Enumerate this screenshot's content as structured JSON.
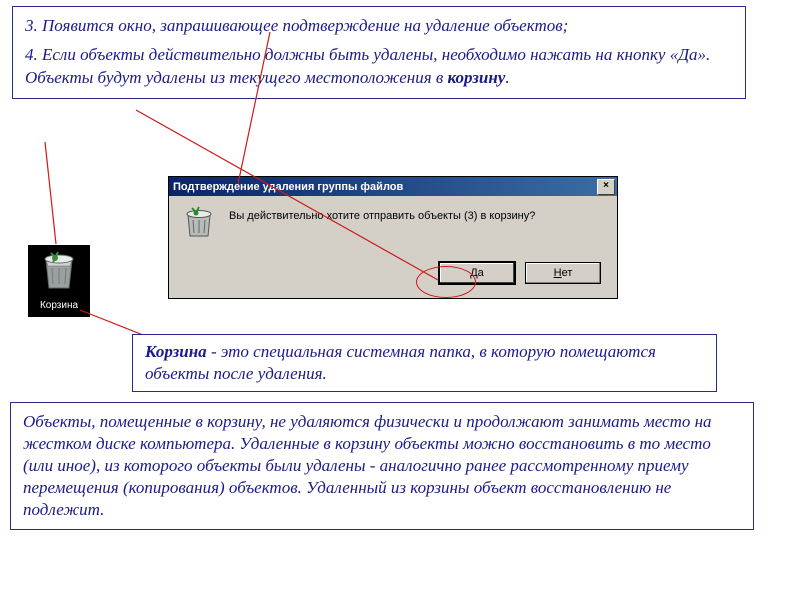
{
  "top": {
    "line3": "3. Появится окно, запрашивающее подтверждение на удаление объектов;",
    "line4_a": "4. Если объекты действительно должны быть удалены, необходимо нажать на кнопку «Да». Объекты будут удалены из текущего местоположения в ",
    "korzinu": "корзину",
    "period": "."
  },
  "bin": {
    "label": "Корзина"
  },
  "dialog": {
    "title": "Подтверждение удаления группы файлов",
    "close": "×",
    "message": "Вы действительно хотите отправить объекты (3) в корзину?",
    "yes_u": "Д",
    "yes_rest": "а",
    "no_u": "Н",
    "no_rest": "ет"
  },
  "mid": {
    "korz": "Корзина",
    "rest": " - это специальная системная папка, в которую помещаются объекты после удаления."
  },
  "bottom": {
    "text": "Объекты, помещенные в корзину, не удаляются  физически и продолжают занимать место на жестком диске компьютера. Удаленные в корзину объекты можно восстановить в то место (или иное), из которого объекты были удалены - аналогично ранее рассмотренному приему перемещения (копирования) объектов. Удаленный из корзины объект восстановлению не подлежит."
  }
}
